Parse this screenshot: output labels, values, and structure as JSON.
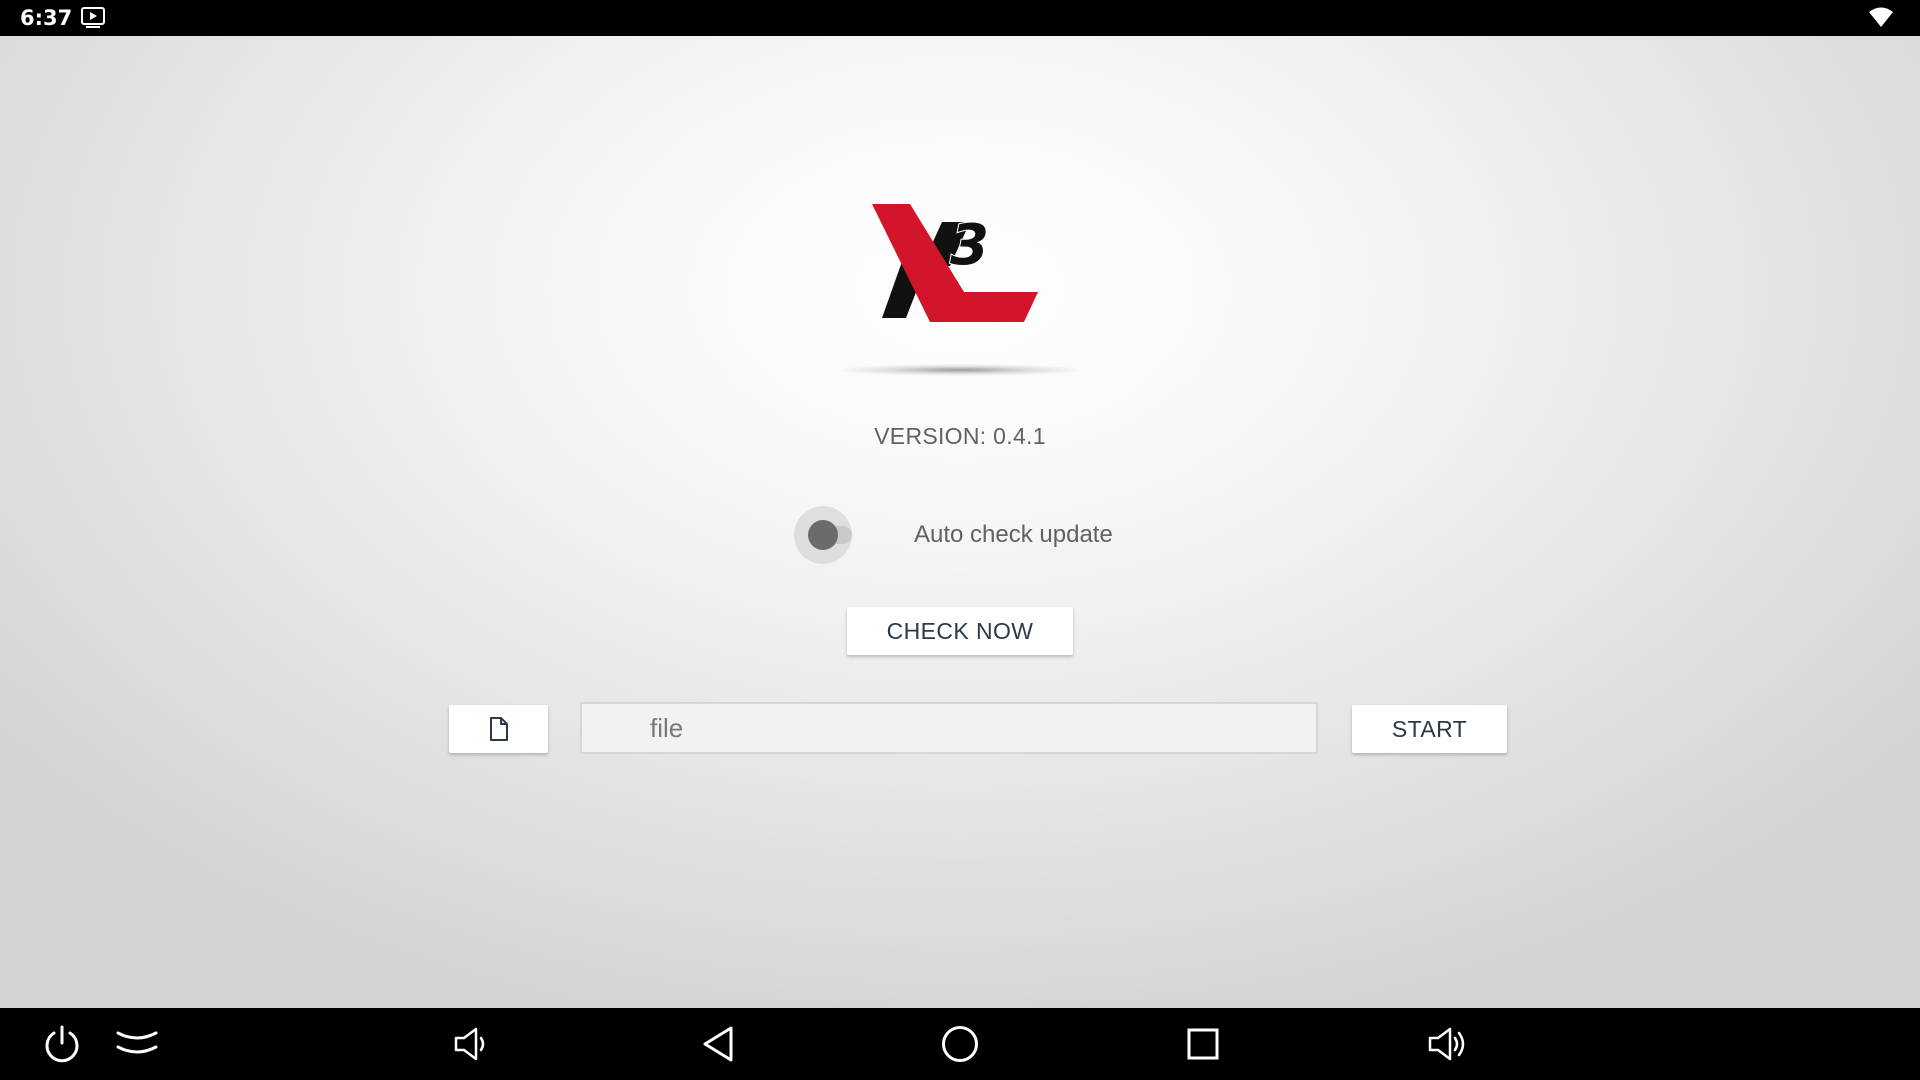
{
  "status_bar": {
    "time": "6:37",
    "icons": [
      "media-notification-icon",
      "wifi-icon"
    ]
  },
  "logo": {
    "text": "X3",
    "colors": {
      "red": "#d2152a",
      "black": "#111111"
    }
  },
  "version_text": "VERSION: 0.4.1",
  "auto_update": {
    "label": "Auto check update",
    "enabled": false
  },
  "check_now_label": "CHECK NOW",
  "file_row": {
    "picker_icon": "file-icon",
    "placeholder": "file",
    "value": "",
    "start_label": "START"
  },
  "nav_bar": {
    "icons": [
      "power-icon",
      "notification-pulldown-icon",
      "volume-down-icon",
      "back-icon",
      "home-icon",
      "recents-icon",
      "volume-up-icon"
    ]
  },
  "colors": {
    "accent_red": "#d2152a",
    "button_text": "#2a3a4a",
    "secondary_text": "#616161"
  }
}
